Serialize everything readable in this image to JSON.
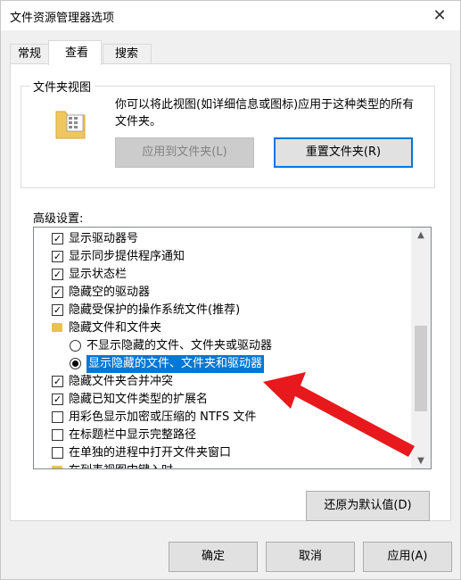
{
  "window": {
    "title": "文件资源管理器选项",
    "close_glyph": "✕"
  },
  "tabs": [
    {
      "label": "常规"
    },
    {
      "label": "查看"
    },
    {
      "label": "搜索"
    }
  ],
  "folder_views": {
    "group_label": "文件夹视图",
    "description": "你可以将此视图(如详细信息或图标)应用于这种类型的所有文件夹。",
    "apply_button": "应用到文件夹(L)",
    "reset_button": "重置文件夹(R)"
  },
  "advanced": {
    "label": "高级设置:",
    "items": [
      {
        "type": "checkbox",
        "checked": true,
        "label": "显示驱动器号"
      },
      {
        "type": "checkbox",
        "checked": true,
        "label": "显示同步提供程序通知"
      },
      {
        "type": "checkbox",
        "checked": true,
        "label": "显示状态栏"
      },
      {
        "type": "checkbox",
        "checked": true,
        "label": "隐藏空的驱动器"
      },
      {
        "type": "checkbox",
        "checked": true,
        "label": "隐藏受保护的操作系统文件(推荐)"
      },
      {
        "type": "folder",
        "label": "隐藏文件和文件夹"
      },
      {
        "type": "radio",
        "checked": false,
        "label": "不显示隐藏的文件、文件夹或驱动器"
      },
      {
        "type": "radio",
        "checked": true,
        "selected": true,
        "label": "显示隐藏的文件、文件夹和驱动器"
      },
      {
        "type": "checkbox",
        "checked": true,
        "label": "隐藏文件夹合并冲突"
      },
      {
        "type": "checkbox",
        "checked": true,
        "label": "隐藏已知文件类型的扩展名"
      },
      {
        "type": "checkbox",
        "checked": false,
        "label": "用彩色显示加密或压缩的 NTFS 文件"
      },
      {
        "type": "checkbox",
        "checked": false,
        "label": "在标题栏中显示完整路径"
      },
      {
        "type": "checkbox",
        "checked": false,
        "label": "在单独的进程中打开文件夹窗口"
      },
      {
        "type": "folder",
        "label": "在列表视图中键入时"
      }
    ],
    "restore_button": "还原为默认值(D)"
  },
  "footer": {
    "ok": "确定",
    "cancel": "取消",
    "apply": "应用(A)"
  },
  "colors": {
    "accent": "#0078d7",
    "annotation_arrow": "#e8191d"
  }
}
